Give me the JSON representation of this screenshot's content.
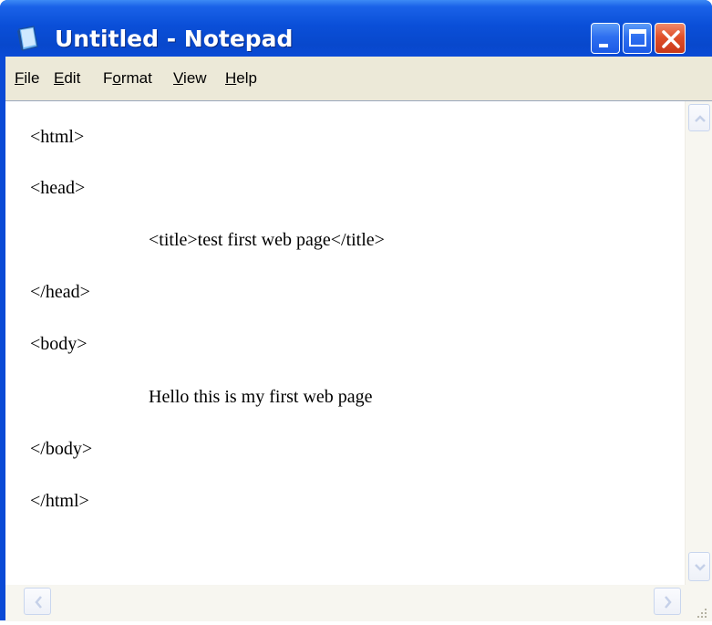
{
  "window": {
    "title": "Untitled - Notepad",
    "icon": "notepad-icon",
    "controls": {
      "minimize_icon": "minimize-icon",
      "maximize_icon": "maximize-icon",
      "close_icon": "close-icon"
    },
    "colors": {
      "titlebar": "#0a4ad6",
      "close_button": "#e0502a",
      "menubar": "#ece9d8"
    }
  },
  "menu": {
    "items": [
      {
        "accel": "F",
        "rest": "ile"
      },
      {
        "accel": "E",
        "rest": "dit"
      },
      {
        "pre": "F",
        "accel": "o",
        "rest": "rmat"
      },
      {
        "accel": "V",
        "rest": "iew"
      },
      {
        "accel": "H",
        "rest": "elp"
      }
    ]
  },
  "editor": {
    "lines": [
      "<html>",
      "<head>",
      "<title>test first web page</title>",
      "</head>",
      "<body>",
      "Hello this is my first web page",
      "</body>",
      "</html>"
    ]
  },
  "scrollbars": {
    "up_icon": "scroll-up-arrow-icon",
    "down_icon": "scroll-down-arrow-icon",
    "left_icon": "scroll-left-arrow-icon",
    "right_icon": "scroll-right-arrow-icon",
    "grip_icon": "size-grip-icon"
  }
}
